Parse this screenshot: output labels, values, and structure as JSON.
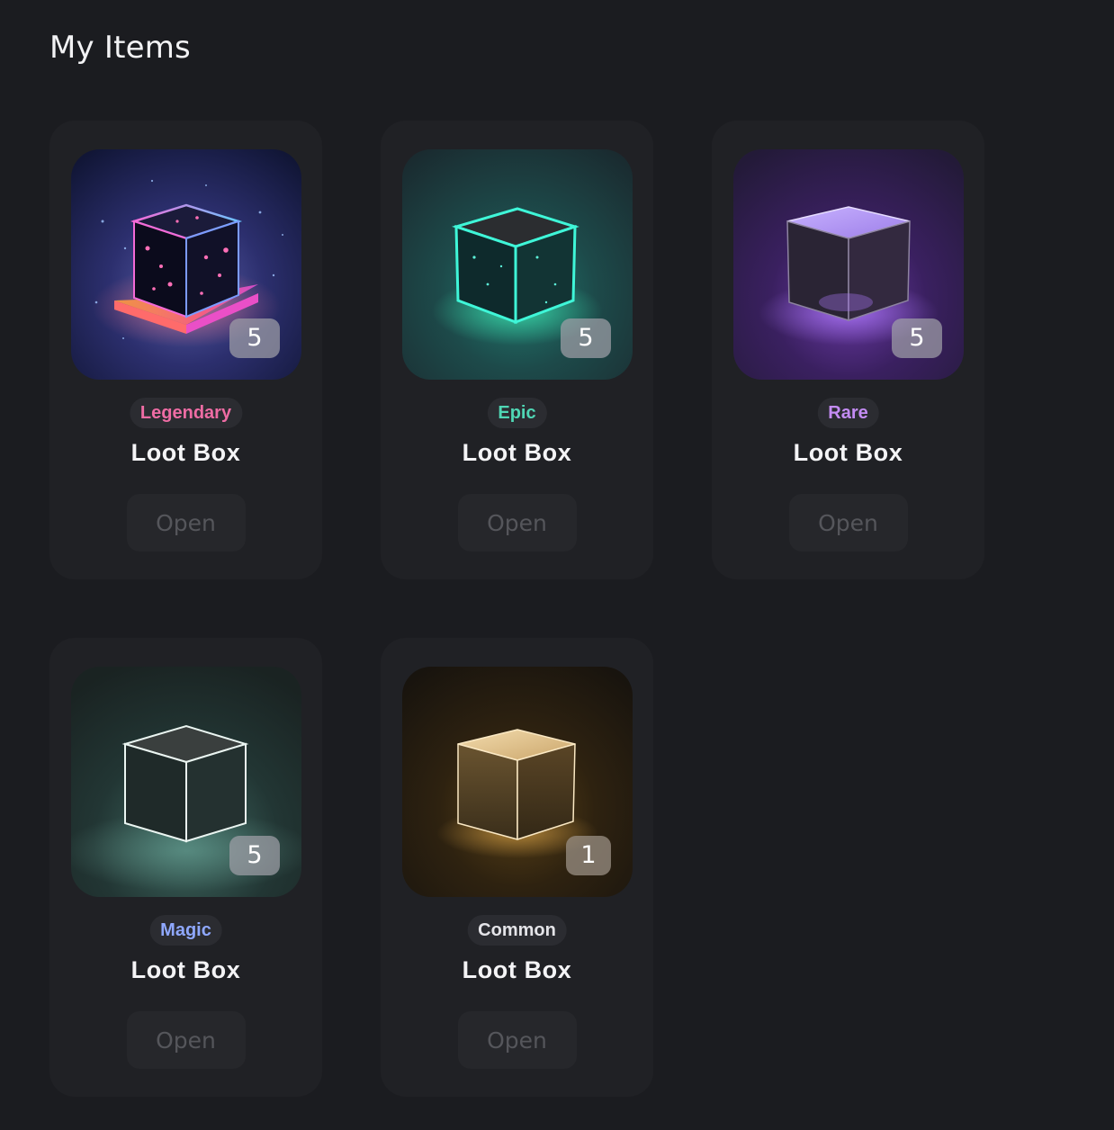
{
  "header": {
    "title": "My Items"
  },
  "items": [
    {
      "rarity": "Legendary",
      "rarity_color": "#ee6ca4",
      "name": "Loot Box",
      "count": "5",
      "button_label": "Open",
      "icon": "legendary-cube-icon"
    },
    {
      "rarity": "Epic",
      "rarity_color": "#4fd6b4",
      "name": "Loot Box",
      "count": "5",
      "button_label": "Open",
      "icon": "epic-cube-icon"
    },
    {
      "rarity": "Rare",
      "rarity_color": "#c48cf4",
      "name": "Loot Box",
      "count": "5",
      "button_label": "Open",
      "icon": "rare-cube-icon"
    },
    {
      "rarity": "Magic",
      "rarity_color": "#8fa8ff",
      "name": "Loot Box",
      "count": "5",
      "button_label": "Open",
      "icon": "magic-cube-icon"
    },
    {
      "rarity": "Common",
      "rarity_color": "#e4e4e8",
      "name": "Loot Box",
      "count": "1",
      "button_label": "Open",
      "icon": "common-cube-icon"
    }
  ]
}
